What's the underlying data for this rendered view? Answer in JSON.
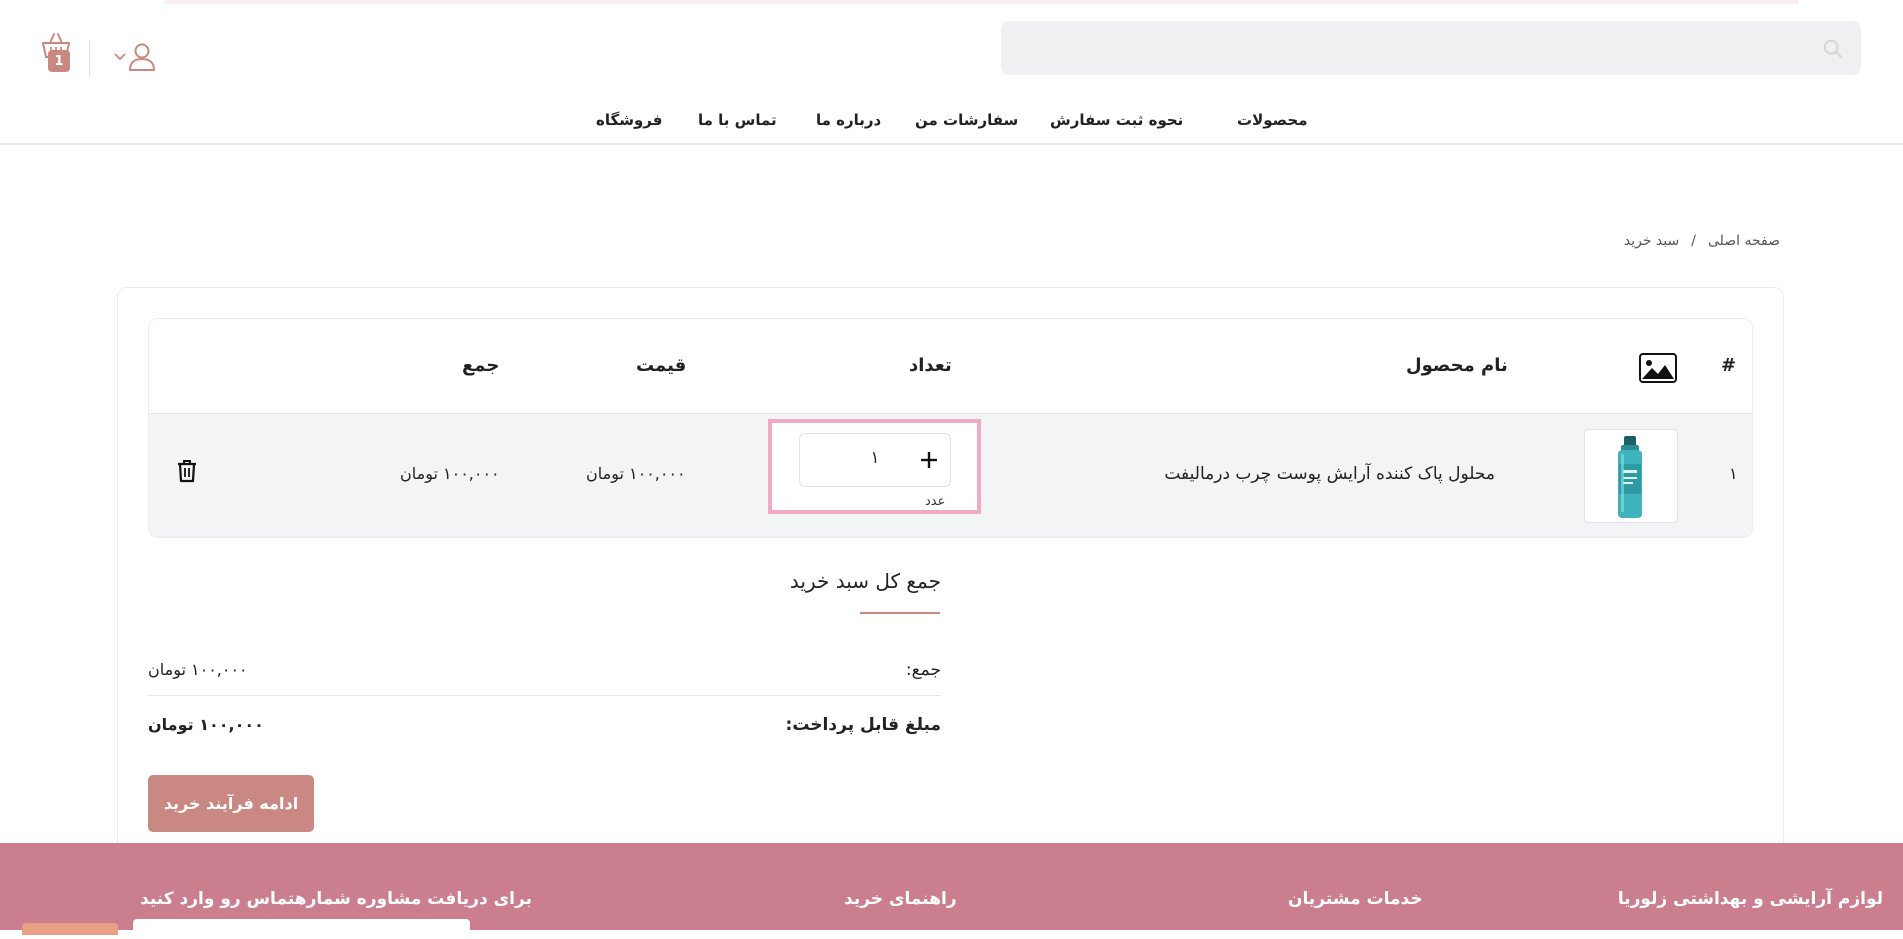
{
  "header": {
    "search": {
      "placeholder": ""
    },
    "cart": {
      "count": "1"
    },
    "nav": [
      {
        "label": "محصولات"
      },
      {
        "label": "نحوه ثبت سفارش"
      },
      {
        "label": "سفارشات من"
      },
      {
        "label": "درباره ما"
      },
      {
        "label": "تماس با ما"
      },
      {
        "label": "فروشگاه"
      }
    ]
  },
  "breadcrumb": {
    "home": "صفحه اصلی",
    "separator": "/",
    "current": "سبد خرید"
  },
  "cart_table": {
    "headers": {
      "index": "#",
      "product_name": "نام محصول",
      "quantity": "تعداد",
      "price": "قیمت",
      "total": "جمع"
    },
    "rows": [
      {
        "index": "۱",
        "product_name": "محلول پاک کننده آرایش پوست چرب درمالیفت",
        "quantity": "۱",
        "unit": "عدد",
        "price": "۱۰۰,۰۰۰ تومان",
        "total": "۱۰۰,۰۰۰ تومان"
      }
    ]
  },
  "summary": {
    "title": "جمع کل سبد خرید",
    "subtotal_label": "جمع:",
    "subtotal_value": "۱۰۰,۰۰۰ تومان",
    "payable_label": "مبلغ قابل پرداخت:",
    "payable_value": "۱۰۰,۰۰۰ تومان",
    "checkout_label": "ادامه فرآیند خرید"
  },
  "footer": {
    "columns": [
      {
        "title": "لوازم آرایشی و بهداشتی زلوریا"
      },
      {
        "title": "خدمات مشتریان"
      },
      {
        "title": "راهنمای خرید"
      },
      {
        "title": "برای دریافت مشاوره شمارهتماس رو وارد کنید"
      }
    ]
  },
  "colors": {
    "accent": "#c98882",
    "footer_bg": "#cb7f8e",
    "highlight_border": "#f0aac6",
    "row_bg": "#f3f4f6"
  }
}
